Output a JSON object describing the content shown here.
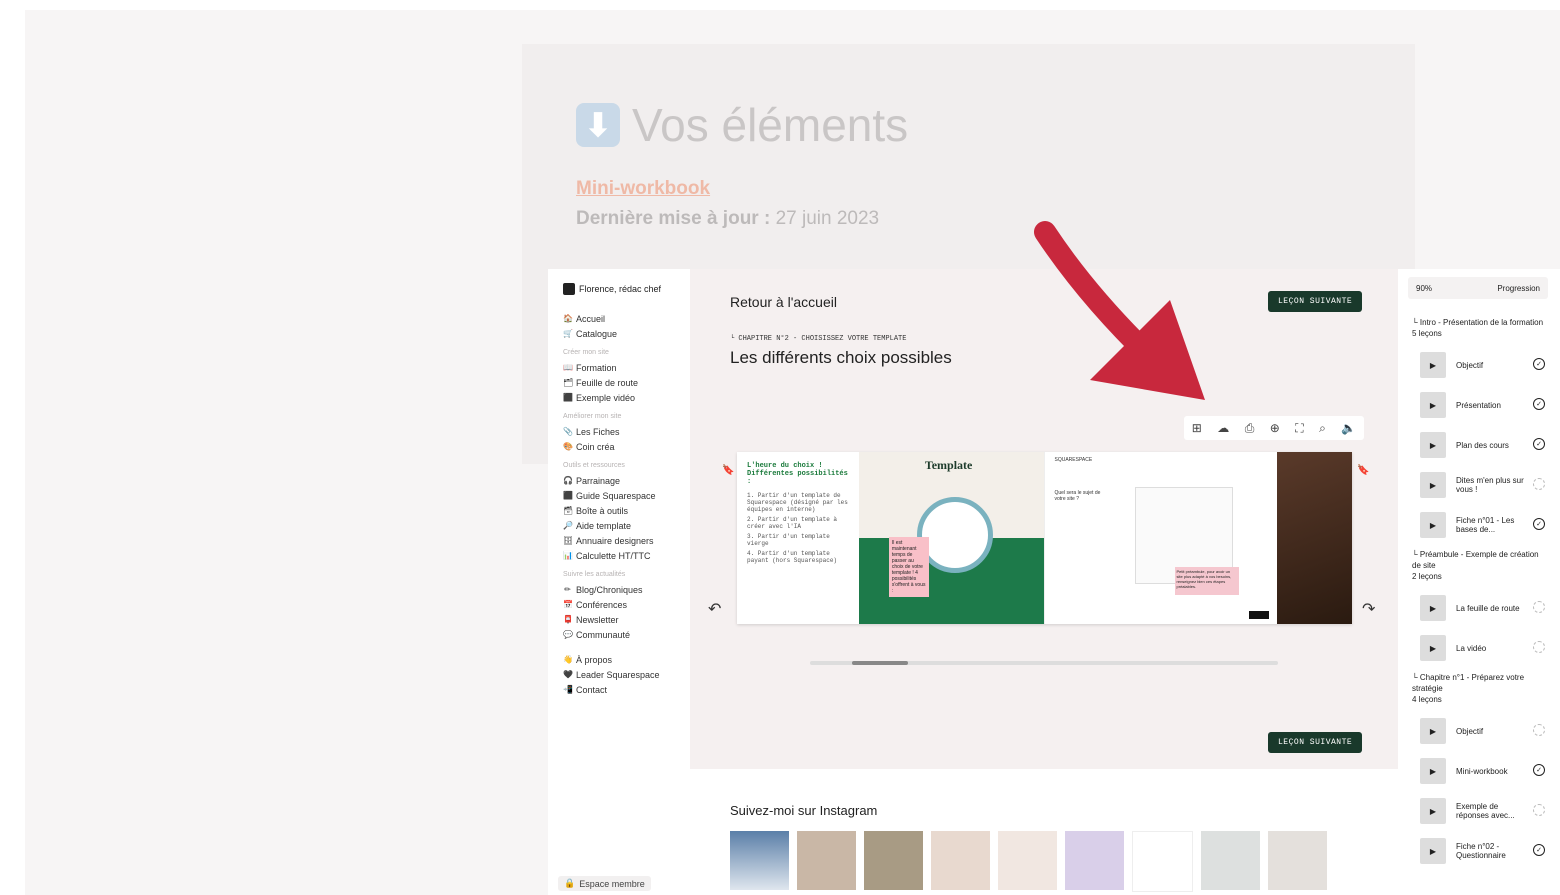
{
  "background": {
    "title_icon": "down-arrow-icon",
    "title": "Vos éléments",
    "link": "Mini-workbook",
    "update_label": "Dernière mise à jour :",
    "update_date": " 27 juin 2023"
  },
  "sidebar": {
    "brand": "Florence, rédac chef",
    "top_items": [
      "Accueil",
      "Catalogue"
    ],
    "sections": [
      {
        "title": "Créer mon site",
        "items": [
          "Formation",
          "Feuille de route",
          "Exemple vidéo"
        ]
      },
      {
        "title": "Améliorer mon site",
        "items": [
          "Les Fiches",
          "Coin créa"
        ]
      },
      {
        "title": "Outils et ressources",
        "items": [
          "Parrainage",
          "Guide Squarespace",
          "Boîte à outils",
          "Aide template",
          "Annuaire designers",
          "Calculette HT/TTC"
        ]
      },
      {
        "title": "Suivre les actualités",
        "items": [
          "Blog/Chroniques",
          "Conférences",
          "Newsletter",
          "Communauté"
        ]
      }
    ],
    "bottom_items": [
      "À propos",
      "Leader Squarespace",
      "Contact"
    ],
    "espace": "Espace membre"
  },
  "main": {
    "back": "Retour à l'accueil",
    "next_label": "LEÇON SUIVANTE",
    "chapter": "└ CHAPITRE N°2 - CHOISISSEZ VOTRE TEMPLATE",
    "title": "Les différents choix possibles",
    "slide1_title": "L'heure du choix ! Différentes possibilités :",
    "slide1_lines": [
      "1. Partir d'un template de Squarespace (désigné par les équipes en interne)",
      "2. Partir d'un template à créer avec l'IA",
      "3. Partir d'un template vierge",
      "4. Partir d'un template payant (hors Squarespace)"
    ],
    "slide2_title": "Template",
    "slide2_note": "Il est maintenant temps de passer au choix de votre template ! 4 possibilités s'offrent à vous :",
    "slide3_brand": "SQUARESPACE",
    "slide3_question": "Quel sera le sujet de votre site ?",
    "slide3_note": "Petit préambule, pour avoir un site plus adapté à vos besoins, renseignez bien ces étapes préalables."
  },
  "instagram": {
    "title": "Suivez-moi sur Instagram"
  },
  "right": {
    "progress_value": "90%",
    "progress_label": "Progression",
    "chapters": [
      {
        "title": "└ Intro - Présentation de la formation",
        "count": "5 leçons",
        "lessons": [
          [
            "Objectif",
            true
          ],
          [
            "Présentation",
            true
          ],
          [
            "Plan des cours",
            true
          ],
          [
            "Dites m'en plus sur vous !",
            false
          ],
          [
            "Fiche n°01 - Les bases de...",
            true
          ]
        ]
      },
      {
        "title": "└ Préambule - Exemple de création de site",
        "count": "2 leçons",
        "lessons": [
          [
            "La feuille de route",
            false
          ],
          [
            "La vidéo",
            false
          ]
        ]
      },
      {
        "title": "└ Chapitre n°1 - Préparez votre stratégie",
        "count": "4 leçons",
        "lessons": [
          [
            "Objectif",
            false
          ],
          [
            "Mini-workbook",
            true
          ],
          [
            "Exemple de réponses avec...",
            false
          ],
          [
            "Fiche n°02 - Questionnaire",
            true
          ]
        ]
      }
    ]
  },
  "colors": {
    "accent": "#19392b",
    "arrow": "#c8283d"
  }
}
